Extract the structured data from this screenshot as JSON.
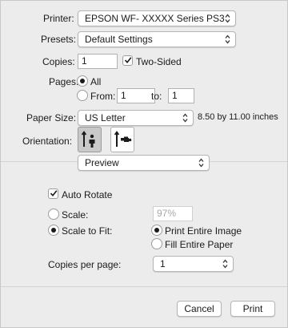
{
  "printer": {
    "label": "Printer:",
    "value": "EPSON WF- XXXXX  Series PS3"
  },
  "presets": {
    "label": "Presets:",
    "value": "Default Settings"
  },
  "copies": {
    "label": "Copies:",
    "value": "1",
    "two_sided_label": "Two-Sided",
    "two_sided_checked": true
  },
  "pages": {
    "label": "Pages:",
    "all_label": "All",
    "from_label": "From:",
    "from_value": "1",
    "to_label": "to:",
    "to_value": "1",
    "selected": "all"
  },
  "paper_size": {
    "label": "Paper Size:",
    "value": "US Letter",
    "dimensions": "8.50 by 11.00 inches"
  },
  "orientation": {
    "label": "Orientation:",
    "selected": "portrait"
  },
  "section_popup": {
    "value": "Preview"
  },
  "preview": {
    "auto_rotate_label": "Auto Rotate",
    "auto_rotate_checked": true,
    "scale_label": "Scale:",
    "scale_value": "97%",
    "scale_to_fit_label": "Scale to Fit:",
    "print_entire_image_label": "Print Entire Image",
    "fill_entire_paper_label": "Fill Entire Paper",
    "scale_mode": "scale_to_fit",
    "fit_mode": "print_entire_image",
    "copies_per_page_label": "Copies per page:",
    "copies_per_page_value": "1"
  },
  "footer": {
    "cancel_label": "Cancel",
    "print_label": "Print"
  }
}
